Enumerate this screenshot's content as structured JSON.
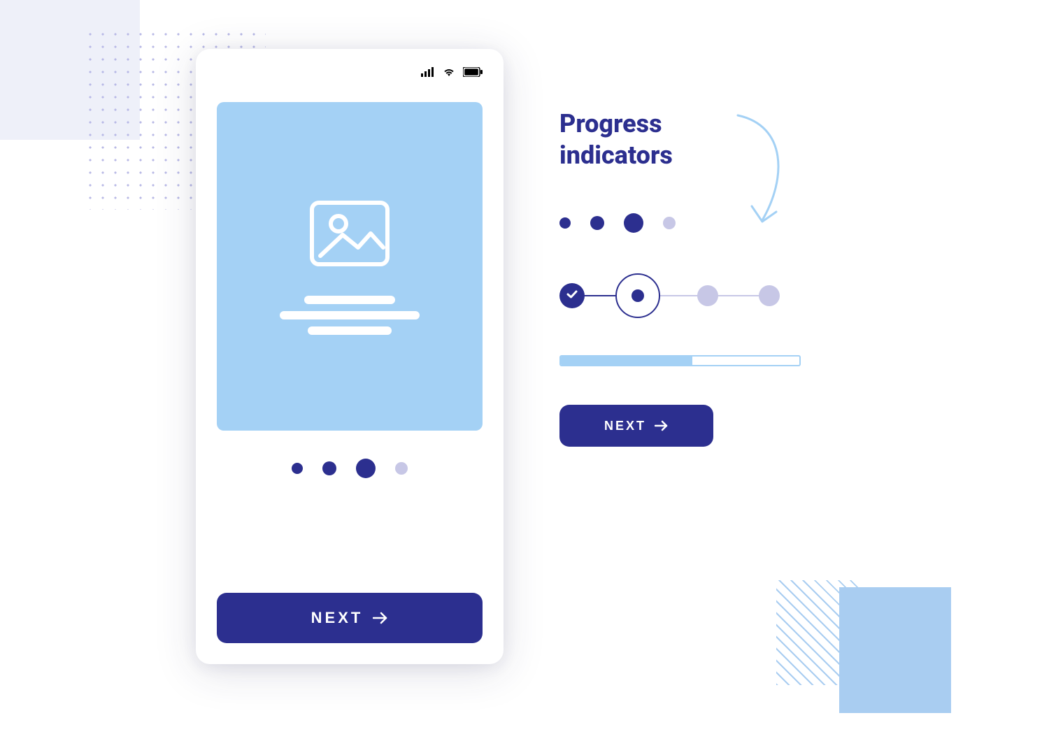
{
  "colors": {
    "primary": "#2c2f8f",
    "light_blue": "#a4d1f5",
    "faded": "#c7c7e6"
  },
  "phone": {
    "dots": {
      "count": 4,
      "active_index": 2
    },
    "next_label": "NEXT"
  },
  "side": {
    "title_line1": "Progress",
    "title_line2": "indicators",
    "dots": {
      "count": 4,
      "active_index": 2
    },
    "steps": {
      "total": 4,
      "completed": 1,
      "current_index": 1
    },
    "progress_bar": {
      "percent": 55
    },
    "next_label": "NEXT"
  }
}
